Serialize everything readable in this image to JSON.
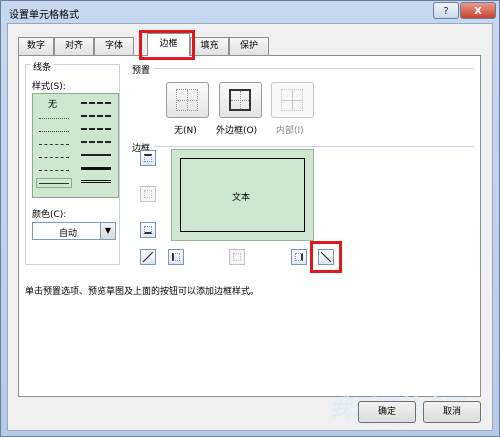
{
  "window": {
    "title": "设置单元格格式",
    "help": "?",
    "close": "X"
  },
  "tabs": [
    "数字",
    "对齐",
    "字体",
    "边框",
    "填充",
    "保护"
  ],
  "line": {
    "group_label": "线条",
    "style_label": "样式(S):",
    "none_label": "无",
    "color_label": "颜色(C):",
    "color_value": "自动"
  },
  "presets": {
    "label": "预置",
    "items": [
      {
        "label": "无(N)"
      },
      {
        "label": "外边框(O)"
      },
      {
        "label": "内部(I)"
      }
    ]
  },
  "border": {
    "label": "边框",
    "preview_text": "文本"
  },
  "hint": "单击预置选项、预览草图及上面的按钮可以添加边框样式。",
  "buttons": {
    "ok": "确定",
    "cancel": "取消"
  },
  "watermark": {
    "main": "我爱IT技术网",
    "sub": "www.52ij.com"
  },
  "colors": {
    "highlight": "#e0191e",
    "preview_bg": "#cfe7cf"
  }
}
